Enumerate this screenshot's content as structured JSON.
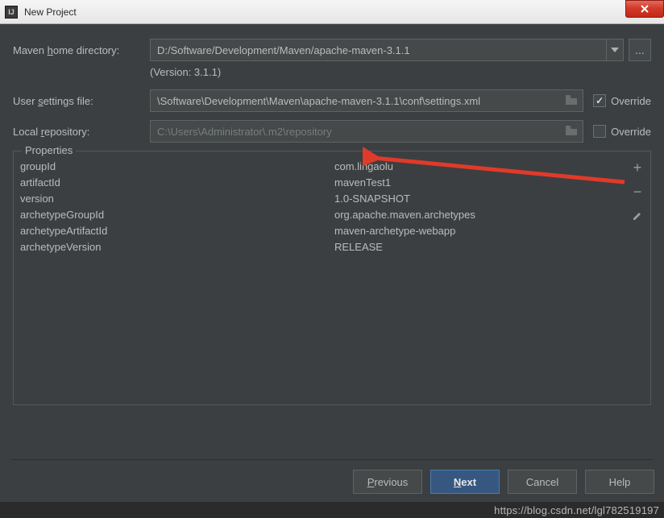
{
  "window": {
    "title": "New Project",
    "icon_label": "IJ"
  },
  "form": {
    "maven_home_label_pre": "Maven ",
    "maven_home_label_mn": "h",
    "maven_home_label_post": "ome directory:",
    "maven_home_value": "D:/Software/Development/Maven/apache-maven-3.1.1",
    "version_text": "(Version: 3.1.1)",
    "user_settings_label_pre": "User ",
    "user_settings_label_mn": "s",
    "user_settings_label_post": "ettings file:",
    "user_settings_value": "\\Software\\Development\\Maven\\apache-maven-3.1.1\\conf\\settings.xml",
    "user_settings_override_checked": true,
    "local_repo_label_pre": "Local ",
    "local_repo_label_mn": "r",
    "local_repo_label_post": "epository:",
    "local_repo_value": "C:\\Users\\Administrator\\.m2\\repository",
    "local_repo_override_checked": false,
    "override_label": "Override"
  },
  "properties": {
    "legend": "Properties",
    "rows": [
      {
        "key": "groupId",
        "value": "com.lingaolu"
      },
      {
        "key": "artifactId",
        "value": "mavenTest1"
      },
      {
        "key": "version",
        "value": "1.0-SNAPSHOT"
      },
      {
        "key": "archetypeGroupId",
        "value": "org.apache.maven.archetypes"
      },
      {
        "key": "archetypeArtifactId",
        "value": "maven-archetype-webapp"
      },
      {
        "key": "archetypeVersion",
        "value": "RELEASE"
      }
    ]
  },
  "buttons": {
    "previous_mn": "P",
    "previous_post": "revious",
    "next_mn": "N",
    "next_post": "ext",
    "cancel": "Cancel",
    "help": "Help"
  },
  "watermark": "https://blog.csdn.net/lgl782519197"
}
